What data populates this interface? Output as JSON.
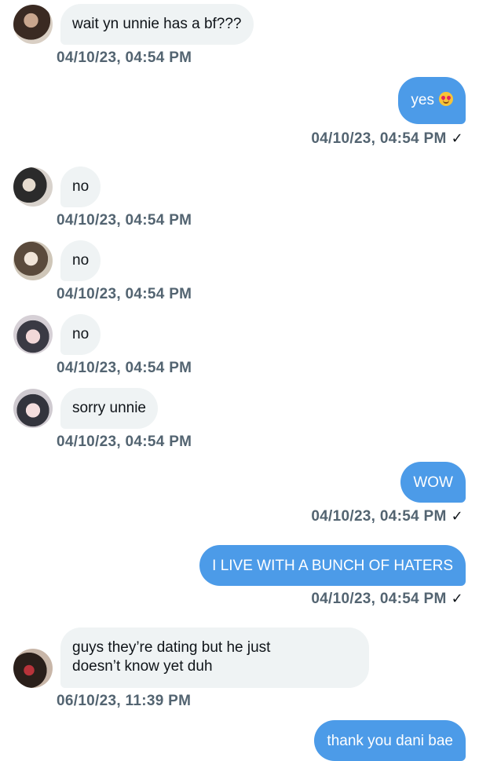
{
  "messages": [
    {
      "direction": "in",
      "avatar": "profile-photo",
      "text": "wait yn unnie has a bf???",
      "timestamp": "04/10/23, 04:54 PM"
    },
    {
      "direction": "out",
      "text": "yes",
      "emoji": "heart-eyes-emoji",
      "timestamp": "04/10/23, 04:54 PM",
      "status": "✓"
    },
    {
      "direction": "in",
      "avatar": "profile-photo",
      "text": "no",
      "timestamp": "04/10/23, 04:54 PM"
    },
    {
      "direction": "in",
      "avatar": "profile-photo",
      "text": "no",
      "timestamp": "04/10/23, 04:54 PM"
    },
    {
      "direction": "in",
      "avatar": "profile-photo",
      "text": "no",
      "timestamp": "04/10/23, 04:54 PM"
    },
    {
      "direction": "in",
      "avatar": "profile-photo",
      "text": "sorry unnie",
      "timestamp": "04/10/23, 04:54 PM"
    },
    {
      "direction": "out",
      "text": "WOW",
      "timestamp": "04/10/23, 04:54 PM",
      "status": "✓"
    },
    {
      "direction": "out",
      "text": "I LIVE WITH A BUNCH OF HATERS",
      "timestamp": "04/10/23, 04:54 PM",
      "status": "✓"
    },
    {
      "direction": "in",
      "avatar": "profile-photo",
      "text": "guys they’re dating but he just\ndoesn’t know yet duh",
      "timestamp": "06/10/23, 11:39 PM"
    },
    {
      "direction": "out",
      "text": "thank you dani bae"
    }
  ],
  "colors": {
    "outgoing_bubble": "#4c9be8",
    "incoming_bubble": "#eff3f4",
    "timestamp": "#536471"
  }
}
